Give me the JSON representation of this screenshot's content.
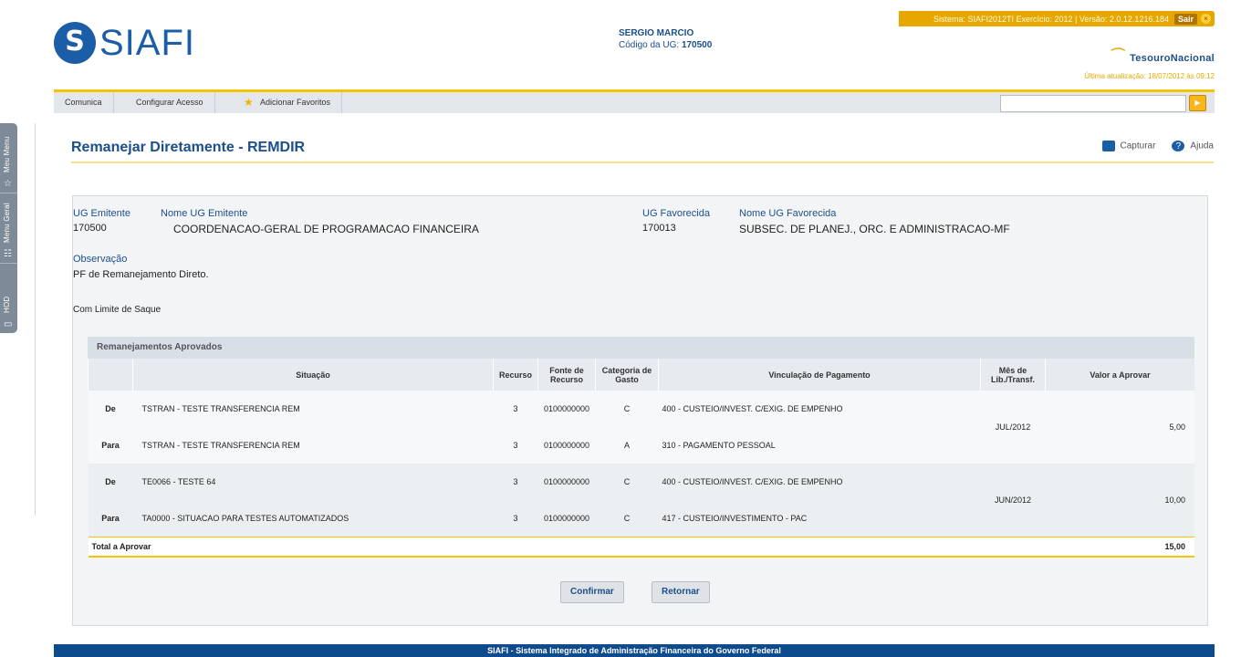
{
  "header": {
    "logo_text": "SIAFI",
    "logo_mark": "S",
    "user_name": "SERGIO MARCIO",
    "ug_label": "Código da UG:",
    "ug_code": "170500",
    "system_line": "Sistema: SIAFI2012TI Exercício: 2012 | Versão: 2.0.12.1216.184",
    "exit_label": "Sair",
    "tesouro_label": "TesouroNacional",
    "last_update": "Última atualização: 18/07/2012 às 09:12"
  },
  "side_tabs": [
    {
      "label": "Meu Menu",
      "icon": "star-icon"
    },
    {
      "label": "Menu Geral",
      "icon": "tree-icon"
    },
    {
      "label": "HOD",
      "icon": "terminal-icon"
    }
  ],
  "menu": {
    "items": [
      "Comunica",
      "Configurar Acesso",
      "Adicionar Favoritos"
    ],
    "search_value": ""
  },
  "page": {
    "title": "Remanejar Diretamente - REMDIR",
    "capture_label": "Capturar",
    "help_label": "Ajuda"
  },
  "form": {
    "ug_emitente_label": "UG Emitente",
    "ug_emitente": "170500",
    "nome_ug_emitente_label": "Nome UG Emitente",
    "nome_ug_emitente": "COORDENACAO-GERAL DE PROGRAMACAO FINANCEIRA",
    "ug_favorecida_label": "UG Favorecida",
    "ug_favorecida": "170013",
    "nome_ug_favorecida_label": "Nome UG Favorecida",
    "nome_ug_favorecida": "SUBSEC. DE PLANEJ., ORC. E ADMINISTRACAO-MF",
    "observacao_label": "Observação",
    "observacao": "PF de Remanejamento Direto.",
    "limite": "Com Limite de Saque"
  },
  "grid": {
    "title": "Remanejamentos Aprovados",
    "columns": [
      "",
      "Situação",
      "Recurso",
      "Fonte de Recurso",
      "Categoria de Gasto",
      "Vinculação de Pagamento",
      "Mês de Lib./Transf.",
      "Valor a Aprovar"
    ],
    "groups": [
      {
        "mes": "JUL/2012",
        "valor": "5,00",
        "rows": [
          {
            "tipo": "De",
            "situacao": "TSTRAN - TESTE TRANSFERENCIA REM",
            "recurso": "3",
            "fonte": "0100000000",
            "categoria": "C",
            "vinculacao": "400 - CUSTEIO/INVEST. C/EXIG. DE EMPENHO"
          },
          {
            "tipo": "Para",
            "situacao": "TSTRAN - TESTE TRANSFERENCIA REM",
            "recurso": "3",
            "fonte": "0100000000",
            "categoria": "A",
            "vinculacao": "310 - PAGAMENTO PESSOAL"
          }
        ]
      },
      {
        "mes": "JUN/2012",
        "valor": "10,00",
        "rows": [
          {
            "tipo": "De",
            "situacao": "TE0066 - TESTE 64",
            "recurso": "3",
            "fonte": "0100000000",
            "categoria": "C",
            "vinculacao": "400 - CUSTEIO/INVEST. C/EXIG. DE EMPENHO"
          },
          {
            "tipo": "Para",
            "situacao": "TA0000 - SITUACAO PARA TESTES AUTOMATIZADOS",
            "recurso": "3",
            "fonte": "0100000000",
            "categoria": "C",
            "vinculacao": "417 - CUSTEIO/INVESTIMENTO - PAC"
          }
        ]
      }
    ],
    "total_label": "Total a Aprovar",
    "total_value": "15,00"
  },
  "buttons": {
    "confirm": "Confirmar",
    "back": "Retornar"
  },
  "footer": "SIAFI - Sistema Integrado de Administração Financeira do Governo Federal"
}
